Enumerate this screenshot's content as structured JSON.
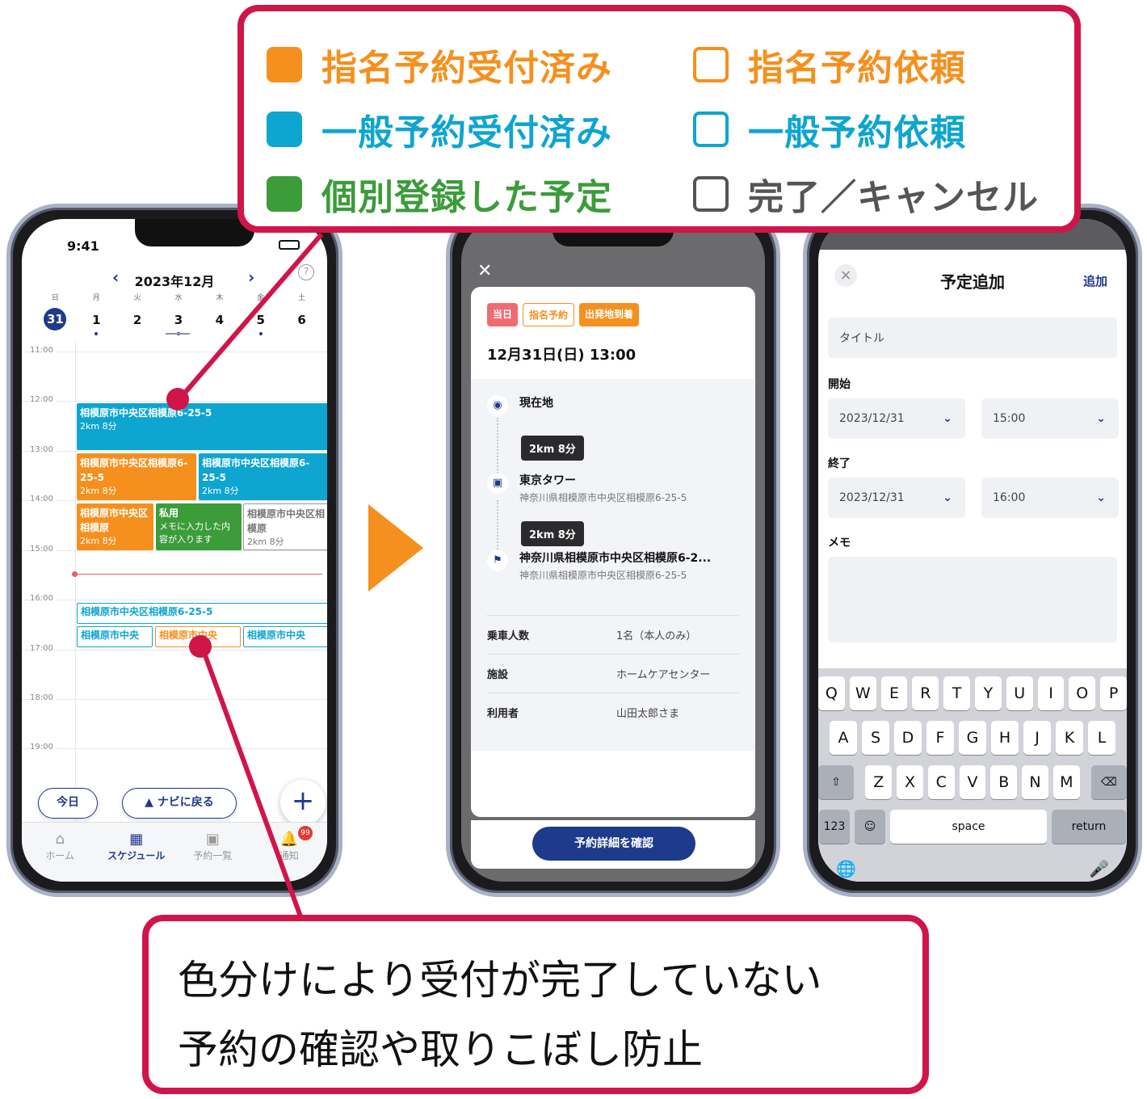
{
  "legend": {
    "items": [
      {
        "label": "指名予約受付済み",
        "color": "#f5901e",
        "style": "filled"
      },
      {
        "label": "指名予約依頼",
        "color": "#f5901e",
        "style": "outline"
      },
      {
        "label": "一般予約受付済み",
        "color": "#0ea5d0",
        "style": "filled"
      },
      {
        "label": "一般予約依頼",
        "color": "#0ea5d0",
        "style": "outline"
      },
      {
        "label": "個別登録した予定",
        "color": "#3c9c3a",
        "style": "filled"
      },
      {
        "label": "完了／キャンセル",
        "color": "#666666",
        "style": "outline"
      }
    ]
  },
  "callout": {
    "line1": "色分けにより受付が完了していない",
    "line2": "予約の確認や取りこぼし防止"
  },
  "calendar": {
    "status_time": "9:41",
    "month": "2023年12月",
    "weekdays": [
      "日",
      "月",
      "火",
      "水",
      "木",
      "金",
      "土"
    ],
    "dates": [
      "31",
      "1",
      "2",
      "3",
      "4",
      "5",
      "6"
    ],
    "hours": [
      "11:00",
      "12:00",
      "13:00",
      "14:00",
      "15:00",
      "16:00",
      "17:00",
      "18:00",
      "19:00"
    ],
    "events": {
      "e1_title": "相模原市中央区相模原6-25-5",
      "e1_sub": "2km 8分",
      "e2_title": "相模原市中央区相模原6-25-5",
      "e2_sub": "2km 8分",
      "e3_title": "相模原市中央区相模原6-25-5",
      "e3_sub": "2km 8分",
      "e4_title": "相模原市中央区相模原",
      "e4_sub": "2km 8分",
      "e5_title": "私用",
      "e5_sub": "メモに入力した内容が入ります",
      "e6_title": "相模原市中央区相模原",
      "e6_sub": "2km 8分",
      "e7_title": "相模原市中央区相模原6-25-5",
      "e8_title": "相模原市中央",
      "e9_title": "相模原市中央",
      "e10_title": "相模原市中央"
    },
    "today_btn": "今日",
    "navi_btn": "ナビに戻る",
    "fab": "+",
    "tabs": [
      "ホーム",
      "スケジュール",
      "予約一覧",
      "通知"
    ],
    "badge": "99"
  },
  "detail": {
    "close": "✕",
    "tags": [
      "当日",
      "指名予約",
      "出発地到着"
    ],
    "datetime": "12月31日(日) 13:00",
    "current": "現在地",
    "dist1": "2km 8分",
    "stop1_name": "東京タワー",
    "stop1_addr": "神奈川県相模原市中央区相模原6-25-5",
    "dist2": "2km 8分",
    "stop2_name": "神奈川県相模原市中央区相模原6-2...",
    "stop2_addr": "神奈川県相模原市中央区相模原6-25-5",
    "rows": [
      {
        "k": "乗車人数",
        "v": "1名（本人のみ）"
      },
      {
        "k": "施設",
        "v": "ホームケアセンター"
      },
      {
        "k": "利用者",
        "v": "山田太郎さま"
      }
    ],
    "confirm_btn": "予約詳細を確認"
  },
  "form": {
    "title": "予定追加",
    "add": "追加",
    "title_placeholder": "タイトル",
    "start_label": "開始",
    "start_date": "2023/12/31",
    "start_time": "15:00",
    "end_label": "終了",
    "end_date": "2023/12/31",
    "end_time": "16:00",
    "memo_label": "メモ",
    "keyboard": {
      "row1": [
        "Q",
        "W",
        "E",
        "R",
        "T",
        "Y",
        "U",
        "I",
        "O",
        "P"
      ],
      "row2": [
        "A",
        "S",
        "D",
        "F",
        "G",
        "H",
        "J",
        "K",
        "L"
      ],
      "row3": [
        "Z",
        "X",
        "C",
        "V",
        "B",
        "N",
        "M"
      ],
      "num": "123",
      "space": "space",
      "return": "return"
    }
  }
}
